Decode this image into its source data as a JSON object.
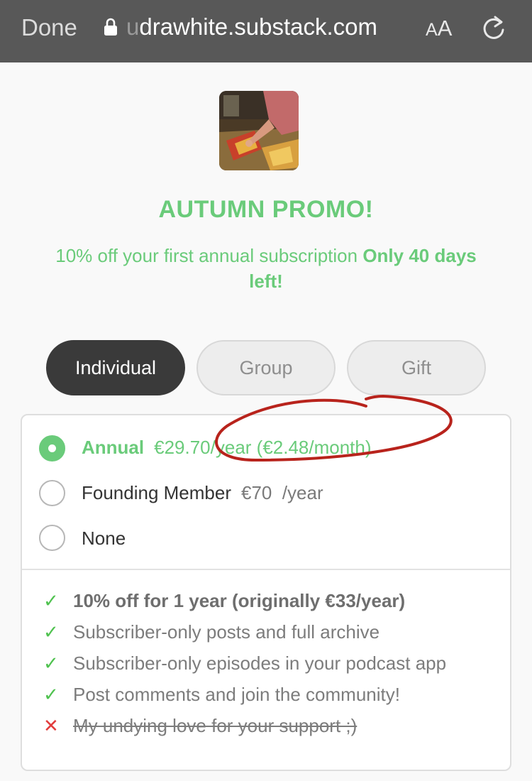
{
  "browser": {
    "done_label": "Done",
    "url_faded": "u",
    "url": "drawhite.substack.com",
    "text_size_small": "A",
    "text_size_large": "A"
  },
  "promo": {
    "title": "AUTUMN PROMO!",
    "subtitle": "10% off your first annual subscription ",
    "highlight": "Only 40 days left!"
  },
  "tabs": [
    {
      "label": "Individual",
      "active": true
    },
    {
      "label": "Group",
      "active": false
    },
    {
      "label": "Gift",
      "active": false
    }
  ],
  "plans": [
    {
      "name": "Annual",
      "price": "€29.70/year (€2.48/month)",
      "selected": true
    },
    {
      "name": "Founding Member",
      "price": "€70  /year",
      "selected": false
    },
    {
      "name": "None",
      "price": "",
      "selected": false
    }
  ],
  "features": [
    {
      "mark": "✓",
      "text": "10% off for 1 year (originally €33/year)",
      "included": true
    },
    {
      "mark": "✓",
      "text": "Subscriber-only posts and full archive",
      "included": true
    },
    {
      "mark": "✓",
      "text": "Subscriber-only episodes in your podcast app",
      "included": true
    },
    {
      "mark": "✓",
      "text": "Post comments and join the community!",
      "included": true
    },
    {
      "mark": "✕",
      "text": "My undying love for your support ;)",
      "included": false
    }
  ],
  "colors": {
    "accent_green": "#6acb7a",
    "tab_active": "#3a3a3a",
    "annotation_red": "#b8231c",
    "check_green": "#4fc24f",
    "cross_red": "#e23b3b"
  }
}
